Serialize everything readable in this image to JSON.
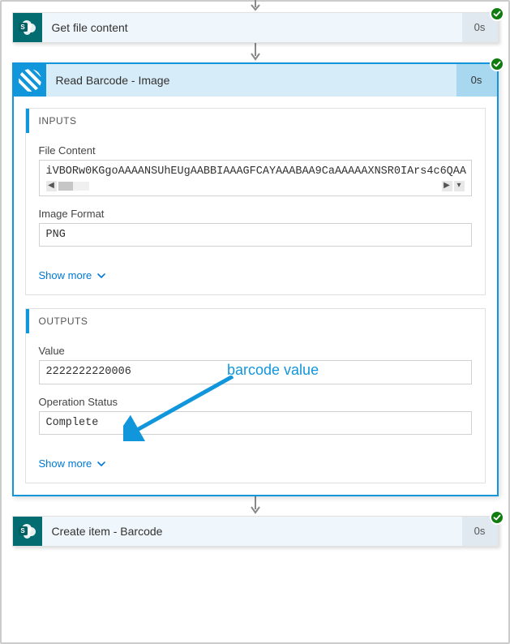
{
  "top_step": {
    "title": "Get file content",
    "duration": "0s"
  },
  "main_step": {
    "title": "Read Barcode - Image",
    "duration": "0s",
    "inputs_heading": "INPUTS",
    "outputs_heading": "OUTPUTS",
    "file_content_label": "File Content",
    "file_content_value": "iVBORw0KGgoAAAANSUhEUgAABBIAAAGFCAYAAABAA9CaAAAAAXNSR0IArs4c6QAA",
    "image_format_label": "Image Format",
    "image_format_value": "PNG",
    "value_label": "Value",
    "value_value": "2222222220006",
    "operation_status_label": "Operation Status",
    "operation_status_value": "Complete",
    "show_more_label": "Show more"
  },
  "bottom_step": {
    "title": "Create item - Barcode",
    "duration": "0s"
  },
  "annotation": {
    "label": "barcode value"
  }
}
